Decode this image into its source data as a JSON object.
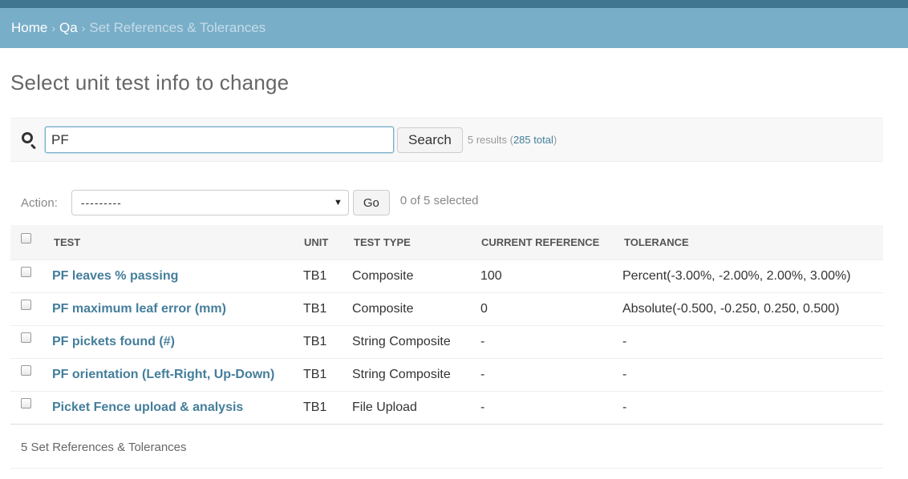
{
  "breadcrumbs": {
    "home": "Home",
    "separator": "›",
    "qa": "Qa",
    "current": "Set References & Tolerances"
  },
  "page_title": "Select unit test info to change",
  "search": {
    "value": "PF",
    "button_label": "Search",
    "result_text": "5 results (",
    "total_link": "285 total",
    "result_close": ")"
  },
  "actions": {
    "label": "Action:",
    "selected_value": "---------",
    "go_label": "Go",
    "selected_count": "0 of 5 selected"
  },
  "table": {
    "columns": [
      "Test",
      "Unit",
      "Test type",
      "Current reference",
      "Tolerance"
    ],
    "rows": [
      {
        "test": "PF leaves % passing",
        "unit": "TB1",
        "type": "Composite",
        "reference": "100",
        "tolerance": "Percent(-3.00%, -2.00%, 2.00%, 3.00%)"
      },
      {
        "test": "PF maximum leaf error (mm)",
        "unit": "TB1",
        "type": "Composite",
        "reference": "0",
        "tolerance": "Absolute(-0.500, -0.250, 0.250, 0.500)"
      },
      {
        "test": "PF pickets found (#)",
        "unit": "TB1",
        "type": "String Composite",
        "reference": "-",
        "tolerance": "-"
      },
      {
        "test": "PF orientation (Left-Right, Up-Down)",
        "unit": "TB1",
        "type": "String Composite",
        "reference": "-",
        "tolerance": "-"
      },
      {
        "test": "Picket Fence upload & analysis",
        "unit": "TB1",
        "type": "File Upload",
        "reference": "-",
        "tolerance": "-"
      }
    ]
  },
  "footer": "5 Set References & Tolerances",
  "colors": {
    "header_dark": "#417690",
    "breadcrumb_bg": "#79aec8",
    "link": "#447e9b"
  }
}
